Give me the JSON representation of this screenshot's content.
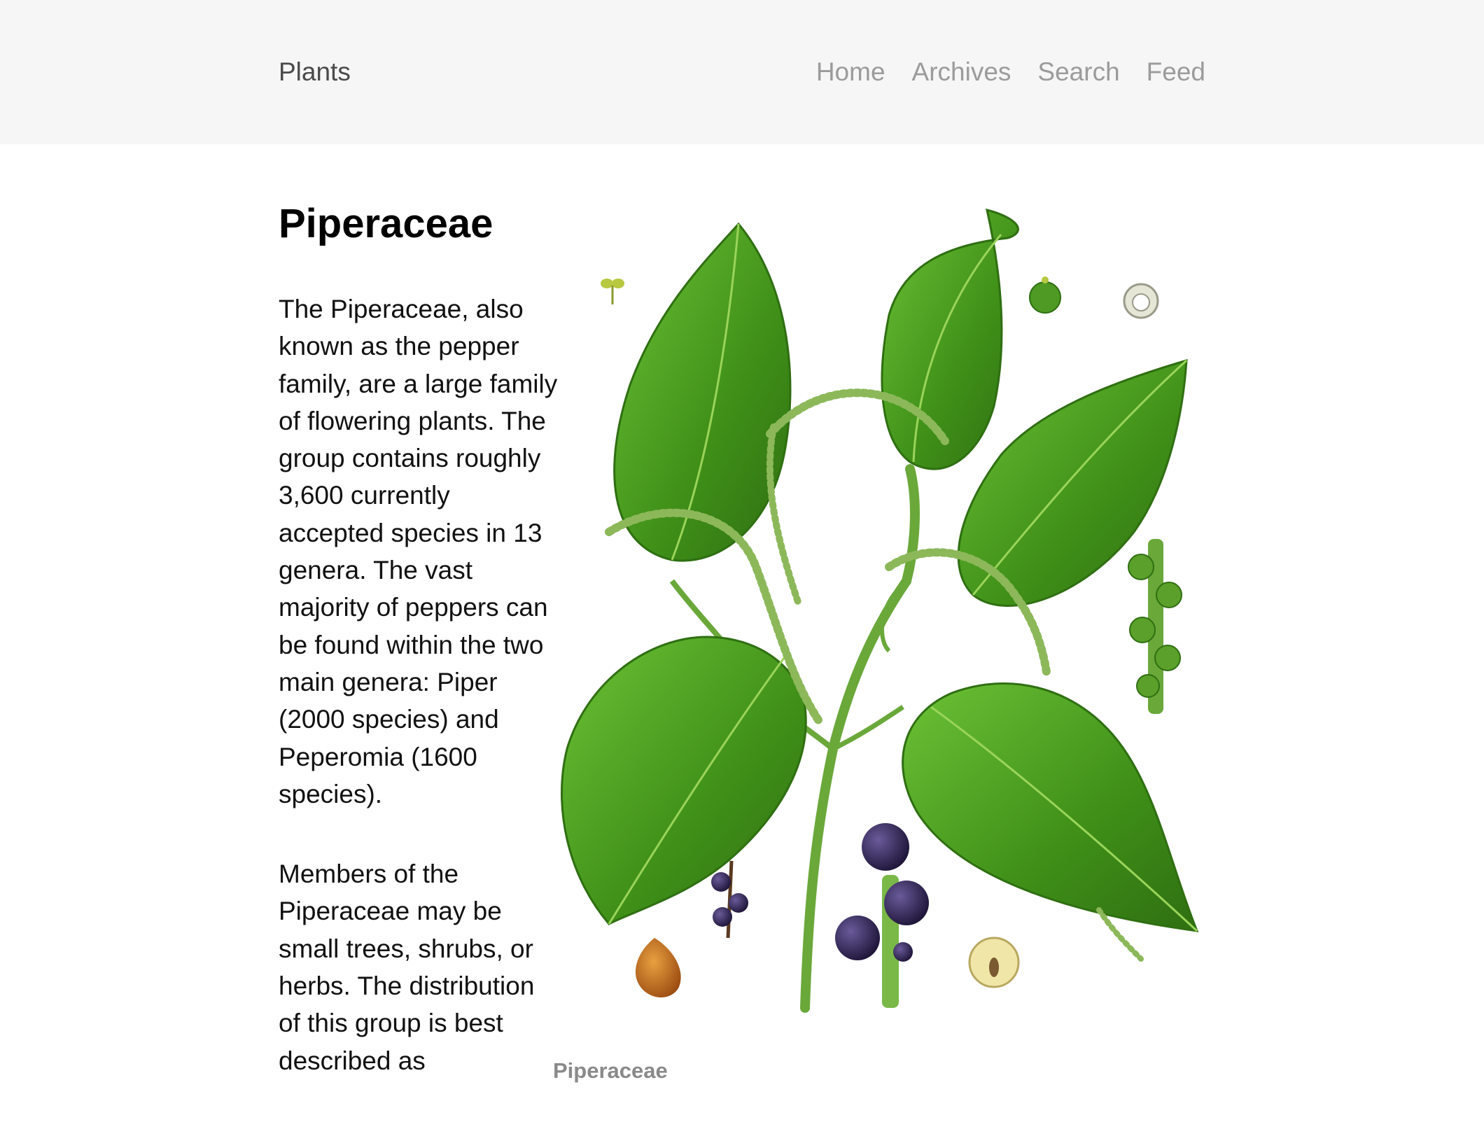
{
  "site": {
    "title": "Plants"
  },
  "nav": {
    "items": [
      {
        "label": "Home"
      },
      {
        "label": "Archives"
      },
      {
        "label": "Search"
      },
      {
        "label": "Feed"
      }
    ]
  },
  "post": {
    "title": "Piperaceae",
    "paragraphs": [
      "The Piperaceae, also known as the pepper family, are a large family of flowering plants. The group contains roughly 3,600 currently accepted species in 13 genera. The vast majority of peppers can be found within the two main genera: Piper (2000 species) and Peperomia (1600 species).",
      "Members of the Piperaceae may be small trees, shrubs, or herbs. The distribution of this group is best described as"
    ]
  },
  "figure": {
    "caption": "Piperaceae",
    "colors": {
      "leaf": "#4a9a1e",
      "leaf_dark": "#2f6f12",
      "stem": "#6aa83a",
      "berry": "#2a1f4a",
      "seed": "#c06a18"
    }
  }
}
